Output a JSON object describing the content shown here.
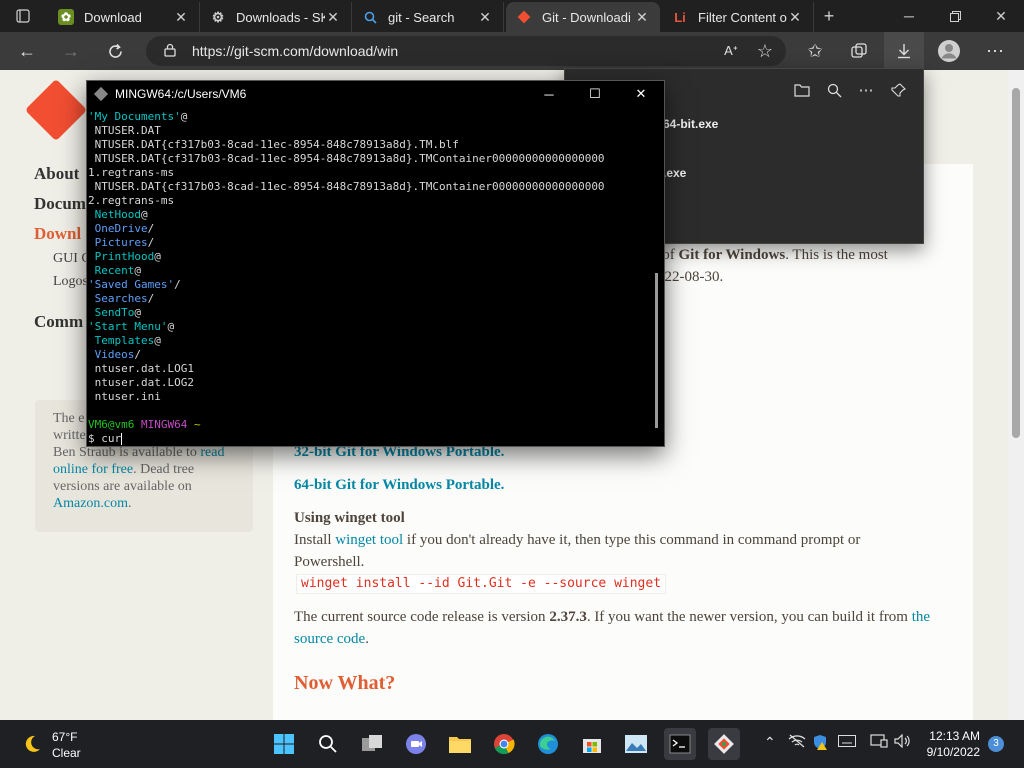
{
  "browser": {
    "tabs": [
      {
        "title": "Download",
        "close": "✕",
        "active": false
      },
      {
        "title": "Downloads - SK",
        "close": "✕",
        "active": false
      },
      {
        "title": "git - Search",
        "close": "✕",
        "active": false
      },
      {
        "title": "Git - Downloadi",
        "close": "✕",
        "active": true
      },
      {
        "title": "Filter Content o",
        "close": "✕",
        "active": false
      }
    ],
    "new_tab": "+",
    "url": "https://git-scm.com/download/win"
  },
  "downloads_panel": {
    "items": [
      "64-bit.exe",
      ".exe"
    ]
  },
  "page": {
    "sidebar": {
      "about": "About",
      "documentation": "Docum",
      "downloads": "Downl",
      "gui": "GUI C",
      "logos": "Logos",
      "community": "Comm",
      "box_line1": "The e",
      "box_line2": "writte",
      "box_line3": "Ben Straub is available to",
      "box_link1": "read",
      "box_link2": "online for free",
      "box_line4": ". Dead tree",
      "box_line5": "versions are available on",
      "box_link3": "Amazon.com",
      "box_line6": "."
    },
    "content": {
      "intro_a": "n of ",
      "intro_bold": "Git for Windows",
      "intro_b": ". This is the most",
      "intro_c": "022-08-30.",
      "portable32": "32-bit Git for Windows Portable.",
      "portable64": "64-bit Git for Windows Portable.",
      "winget_heading": "Using winget tool",
      "winget_a": "Install ",
      "winget_link": "winget tool",
      "winget_b": " if you don't already have it, then type this command in command prompt or",
      "winget_c": "Powershell.",
      "winget_cmd": "winget install --id Git.Git -e --source winget",
      "source_a": "The current source code release is version ",
      "source_version": "2.37.3",
      "source_b": ". If you want the newer version, you can build it from ",
      "source_link1": "the",
      "source_link2": "source code",
      "source_c": ".",
      "now_what": "Now What?"
    }
  },
  "terminal": {
    "title": "MINGW64:/c/Users/VM6",
    "lines": [
      {
        "text": "'My Documents'",
        "suffix": "@",
        "color": "cyan"
      },
      {
        "text": " NTUSER.DAT",
        "suffix": "",
        "color": "white"
      },
      {
        "text": " NTUSER.DAT{cf317b03-8cad-11ec-8954-848c78913a8d}.TM.blf",
        "suffix": "",
        "color": "white"
      },
      {
        "text": " NTUSER.DAT{cf317b03-8cad-11ec-8954-848c78913a8d}.TMContainer00000000000000000",
        "suffix": "",
        "color": "white"
      },
      {
        "text": "1.regtrans-ms",
        "suffix": "",
        "color": "white"
      },
      {
        "text": " NTUSER.DAT{cf317b03-8cad-11ec-8954-848c78913a8d}.TMContainer00000000000000000",
        "suffix": "",
        "color": "white"
      },
      {
        "text": "2.regtrans-ms",
        "suffix": "",
        "color": "white"
      },
      {
        "text": " NetHood",
        "suffix": "@",
        "color": "cyan"
      },
      {
        "text": " OneDrive",
        "suffix": "/",
        "color": "blue"
      },
      {
        "text": " Pictures",
        "suffix": "/",
        "color": "blue"
      },
      {
        "text": " PrintHood",
        "suffix": "@",
        "color": "cyan"
      },
      {
        "text": " Recent",
        "suffix": "@",
        "color": "cyan"
      },
      {
        "text": "'Saved Games'",
        "suffix": "/",
        "color": "blue"
      },
      {
        "text": " Searches",
        "suffix": "/",
        "color": "blue"
      },
      {
        "text": " SendTo",
        "suffix": "@",
        "color": "cyan"
      },
      {
        "text": "'Start Menu'",
        "suffix": "@",
        "color": "cyan"
      },
      {
        "text": " Templates",
        "suffix": "@",
        "color": "cyan"
      },
      {
        "text": " Videos",
        "suffix": "/",
        "color": "blue"
      },
      {
        "text": " ntuser.dat.LOG1",
        "suffix": "",
        "color": "white"
      },
      {
        "text": " ntuser.dat.LOG2",
        "suffix": "",
        "color": "white"
      },
      {
        "text": " ntuser.ini",
        "suffix": "",
        "color": "white"
      }
    ],
    "prompt_user": "VM6@vm6",
    "prompt_env": "MINGW64",
    "prompt_path": "~",
    "input": "$ cur"
  },
  "taskbar": {
    "weather_temp": "67°F",
    "weather_cond": "Clear",
    "time": "12:13 AM",
    "date": "9/10/2022",
    "notifications": "3"
  }
}
